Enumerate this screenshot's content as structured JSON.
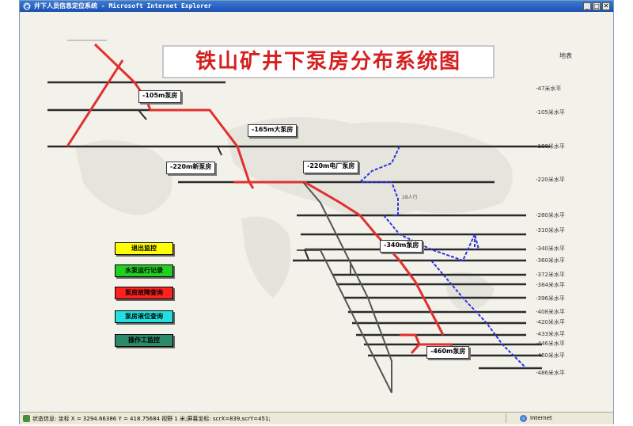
{
  "window": {
    "title": "井下人员信息定位系统 - Microsoft Internet Explorer",
    "controls": [
      "_",
      "□",
      "✕"
    ]
  },
  "diagram": {
    "title": "铁山矿井下泵房分布系统图",
    "corner_label": "地表",
    "pump_rooms": [
      "-105m泵房",
      "-165m大泵房",
      "-220m新泵房",
      "-220m电厂泵房",
      "-340m泵房",
      "-460m泵房"
    ],
    "levels": [
      "-47米水平",
      "-105米水平",
      "-160米水平",
      "-220米水平",
      "-280米水平",
      "-310米水平",
      "-340米水平",
      "-360米水平",
      "-372米水平",
      "-384米水平",
      "-396米水平",
      "-408米水平",
      "-420米水平",
      "-433米水平",
      "-446米水平",
      "-460米水平",
      "-486米水平"
    ],
    "annotation": "28人行",
    "colors": {
      "red_pipe": "#e0302f",
      "blue_pipe": "#2b36d8",
      "gray_shaft": "#555555",
      "level_line": "#2a2a2a"
    }
  },
  "menu_buttons": [
    {
      "label": "退出监控",
      "color": "#ffff00"
    },
    {
      "label": "水泵运行记录",
      "color": "#22d022"
    },
    {
      "label": "泵房故障查询",
      "color": "#ff2020"
    },
    {
      "label": "泵房液位查询",
      "color": "#22e0e0"
    },
    {
      "label": "操作工监控",
      "color": "#2a8a6a"
    }
  ],
  "statusbar": {
    "text": "状态信息: 坐标 X = 3294.66386 Y = 418.75684 视野 1 米;屏幕坐标: scrX=839,scrY=451;",
    "zone": "Internet"
  }
}
